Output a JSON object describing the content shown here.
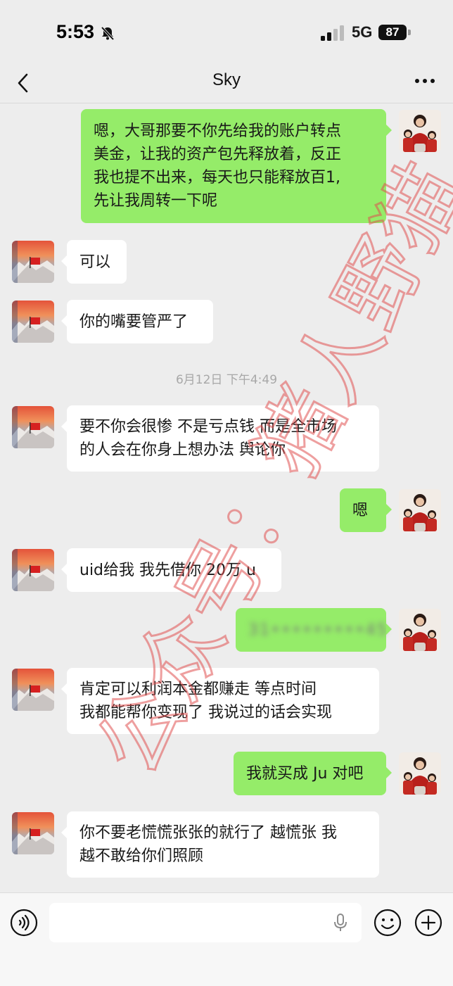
{
  "status_bar": {
    "time": "5:53",
    "network": "5G",
    "battery": "87",
    "icons": [
      "bell-muted-icon",
      "signal-icon"
    ]
  },
  "header": {
    "title": "Sky",
    "icons": [
      "back-chevron-icon",
      "more-dots-icon"
    ]
  },
  "timestamp": "6月12日 下午4:49",
  "messages": [
    {
      "side": "out",
      "text": "嗯，大哥那要不你先给我的账户转点\n美金，让我的资产包先释放着，反正\n我也提不出来，每天也只能释放百1,\n先让我周转一下呢"
    },
    {
      "side": "in",
      "text": "可以"
    },
    {
      "side": "in",
      "text": "你的嘴要管严了"
    },
    {
      "side": "in",
      "text": "要不你会很惨 不是亏点钱 而是全市场\n的人会在你身上想办法 舆论你"
    },
    {
      "side": "out",
      "text": "嗯"
    },
    {
      "side": "in",
      "text": "uid给我 我先借你 20万 u"
    },
    {
      "side": "out",
      "text": "31•••••••••45"
    },
    {
      "side": "in",
      "text": "肯定可以利润本金都赚走  等点时间\n我都能帮你变现了  我说过的话会实现"
    },
    {
      "side": "out",
      "text": "我就买成 Ju 对吧"
    },
    {
      "side": "in",
      "text": "你不要老慌慌张张的就行了 越慌张 我\n越不敢给你们照顾"
    }
  ],
  "watermark": "公众号：猪人野猫",
  "input_bar": {
    "icons": [
      "voice-icon",
      "mic-icon",
      "emoji-icon",
      "plus-icon"
    ]
  },
  "colors": {
    "background": "#ededed",
    "out_bubble": "#95ec69",
    "in_bubble": "#ffffff",
    "watermark": "#e05050"
  }
}
